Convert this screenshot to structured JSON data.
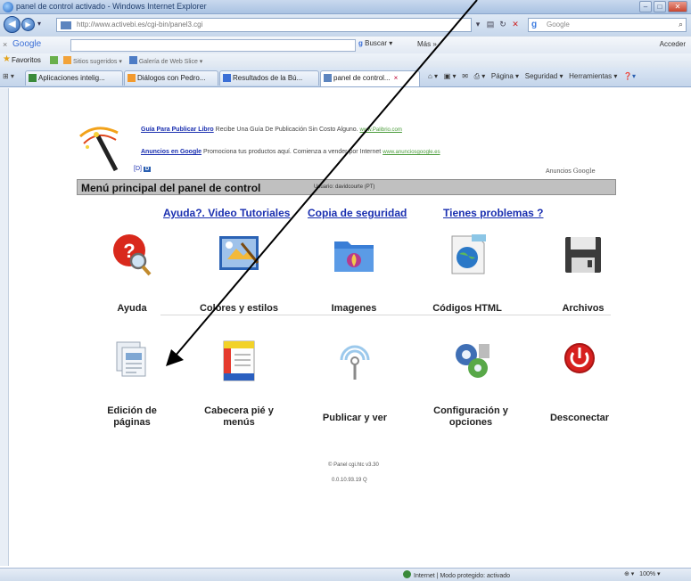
{
  "browser": {
    "window_title": "panel de control activado - Windows Internet Explorer",
    "address": "http://www.activebi.es/cgi-bin/panel3.cgi",
    "address_domain": "activebi.es",
    "search_placeholder": "Google",
    "google_bar": {
      "logo": "Google",
      "search_button": "Buscar",
      "more": "Más »",
      "account": "Acceder"
    },
    "favorites": {
      "label": "Favoritos",
      "items": [
        "Sitios sugeridos",
        "Galería de Web Slice"
      ]
    },
    "tabs": [
      {
        "label": "Aplicaciones intelig..."
      },
      {
        "label": "Diálogos con Pedro..."
      },
      {
        "label": "Resultados de la Bú..."
      },
      {
        "label": "panel de control..."
      }
    ],
    "commands": [
      "Página",
      "Seguridad",
      "Herramientas"
    ],
    "status": {
      "zone": "Internet | Modo protegido: activado",
      "zoom": "100%"
    }
  },
  "ads": {
    "line1_link": "Guía Para Publicar Libro",
    "line1_text": "Recibe Una Guía De Publicación Sin Costo Alguno.",
    "line1_url": "www.Palibrio.com",
    "line2_link": "Anuncios en Google",
    "line2_text": "Promociona tus productos aquí. Comienza a vender por Internet",
    "line2_url": "www.anunciosgoogle.es",
    "adchoices": "D",
    "ads_by_label": "Anuncios",
    "ads_by_brand": "Google"
  },
  "panel": {
    "title": "Menú principal del panel de control",
    "user": "Usuario: davidcourte (PT)",
    "links": [
      "Ayuda?. Video Tutoriales",
      "Copia de seguridad",
      "Tienes problemas ?"
    ],
    "row1": [
      {
        "label": "Ayuda",
        "icon": "help-icon"
      },
      {
        "label": "Colores y estilos",
        "icon": "colors-styles-icon"
      },
      {
        "label": "Imagenes",
        "icon": "images-folder-icon"
      },
      {
        "label": "Códigos HTML",
        "icon": "html-globe-icon"
      },
      {
        "label": "Archivos",
        "icon": "floppy-disk-icon"
      }
    ],
    "row2": [
      {
        "label1": "Edición de",
        "label2": "páginas",
        "icon": "edit-pages-icon"
      },
      {
        "label1": "Cabecera pié y",
        "label2": "menús",
        "icon": "header-footer-icon"
      },
      {
        "label1": "Publicar y ver",
        "label2": "",
        "icon": "publish-antenna-icon"
      },
      {
        "label1": "Configuración y",
        "label2": "opciones",
        "icon": "settings-gears-icon"
      },
      {
        "label1": "Desconectar",
        "label2": "",
        "icon": "power-icon"
      }
    ],
    "footer1": "© Panel cgi.htc v3.30",
    "footer2": "0.0.10.93.19 Q"
  },
  "colors": {
    "link": "#1a2fb0",
    "menubar": "#c0c0c0",
    "power_red": "#d7201f"
  }
}
